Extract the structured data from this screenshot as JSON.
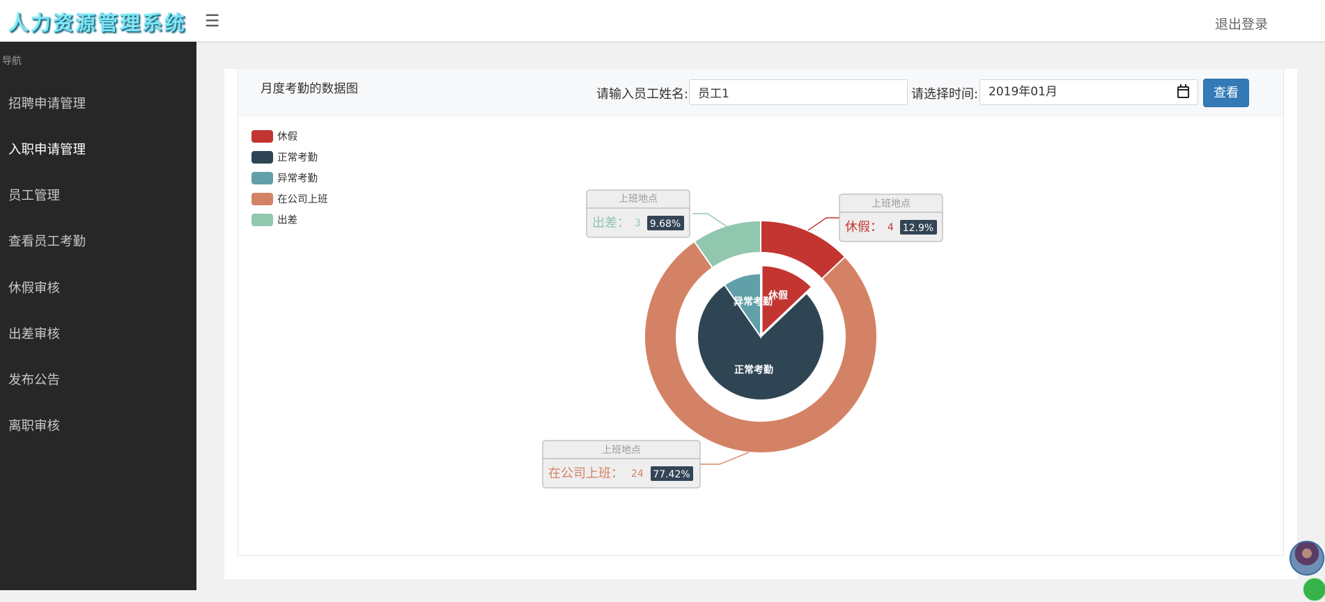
{
  "header": {
    "logo": "人力资源管理系统",
    "menu_icon": "hamburger-icon",
    "logout": "退出登录"
  },
  "sidebar": {
    "title": "导航",
    "items": [
      {
        "label": "招聘申请管理"
      },
      {
        "label": "入职申请管理"
      },
      {
        "label": "员工管理"
      },
      {
        "label": "查看员工考勤"
      },
      {
        "label": "休假审核"
      },
      {
        "label": "出差审核"
      },
      {
        "label": "发布公告"
      },
      {
        "label": "离职审核"
      }
    ]
  },
  "main": {
    "title": "月度考勤的数据图",
    "employee_label": "请输入员工姓名:",
    "employee_value": "员工1",
    "date_label": "请选择时间:",
    "date_value": "2019年01月",
    "view_button": "查看"
  },
  "colors": {
    "leave": "#c23531",
    "normal": "#2f4554",
    "abnormal": "#61a0a8",
    "office": "#d48265",
    "trip": "#91c7ae",
    "button": "#337ab7",
    "sidebar": "#272727"
  },
  "chart_data": {
    "type": "pie",
    "legend_position": "top-left",
    "legend": [
      "休假",
      "正常考勤",
      "异常考勤",
      "在公司上班",
      "出差"
    ],
    "inner": [
      {
        "name": "休假",
        "value": 4,
        "color": "#c23531"
      },
      {
        "name": "正常考勤",
        "value": 24,
        "color": "#2f4554"
      },
      {
        "name": "异常考勤",
        "value": 3,
        "color": "#61a0a8"
      }
    ],
    "outer": [
      {
        "name": "休假",
        "value": 4,
        "percent": "12.9%",
        "color": "#c23531"
      },
      {
        "name": "在公司上班",
        "value": 24,
        "percent": "77.42%",
        "color": "#d48265"
      },
      {
        "name": "出差",
        "value": 3,
        "percent": "9.68%",
        "color": "#91c7ae"
      }
    ],
    "callout_title": "上班地点"
  }
}
